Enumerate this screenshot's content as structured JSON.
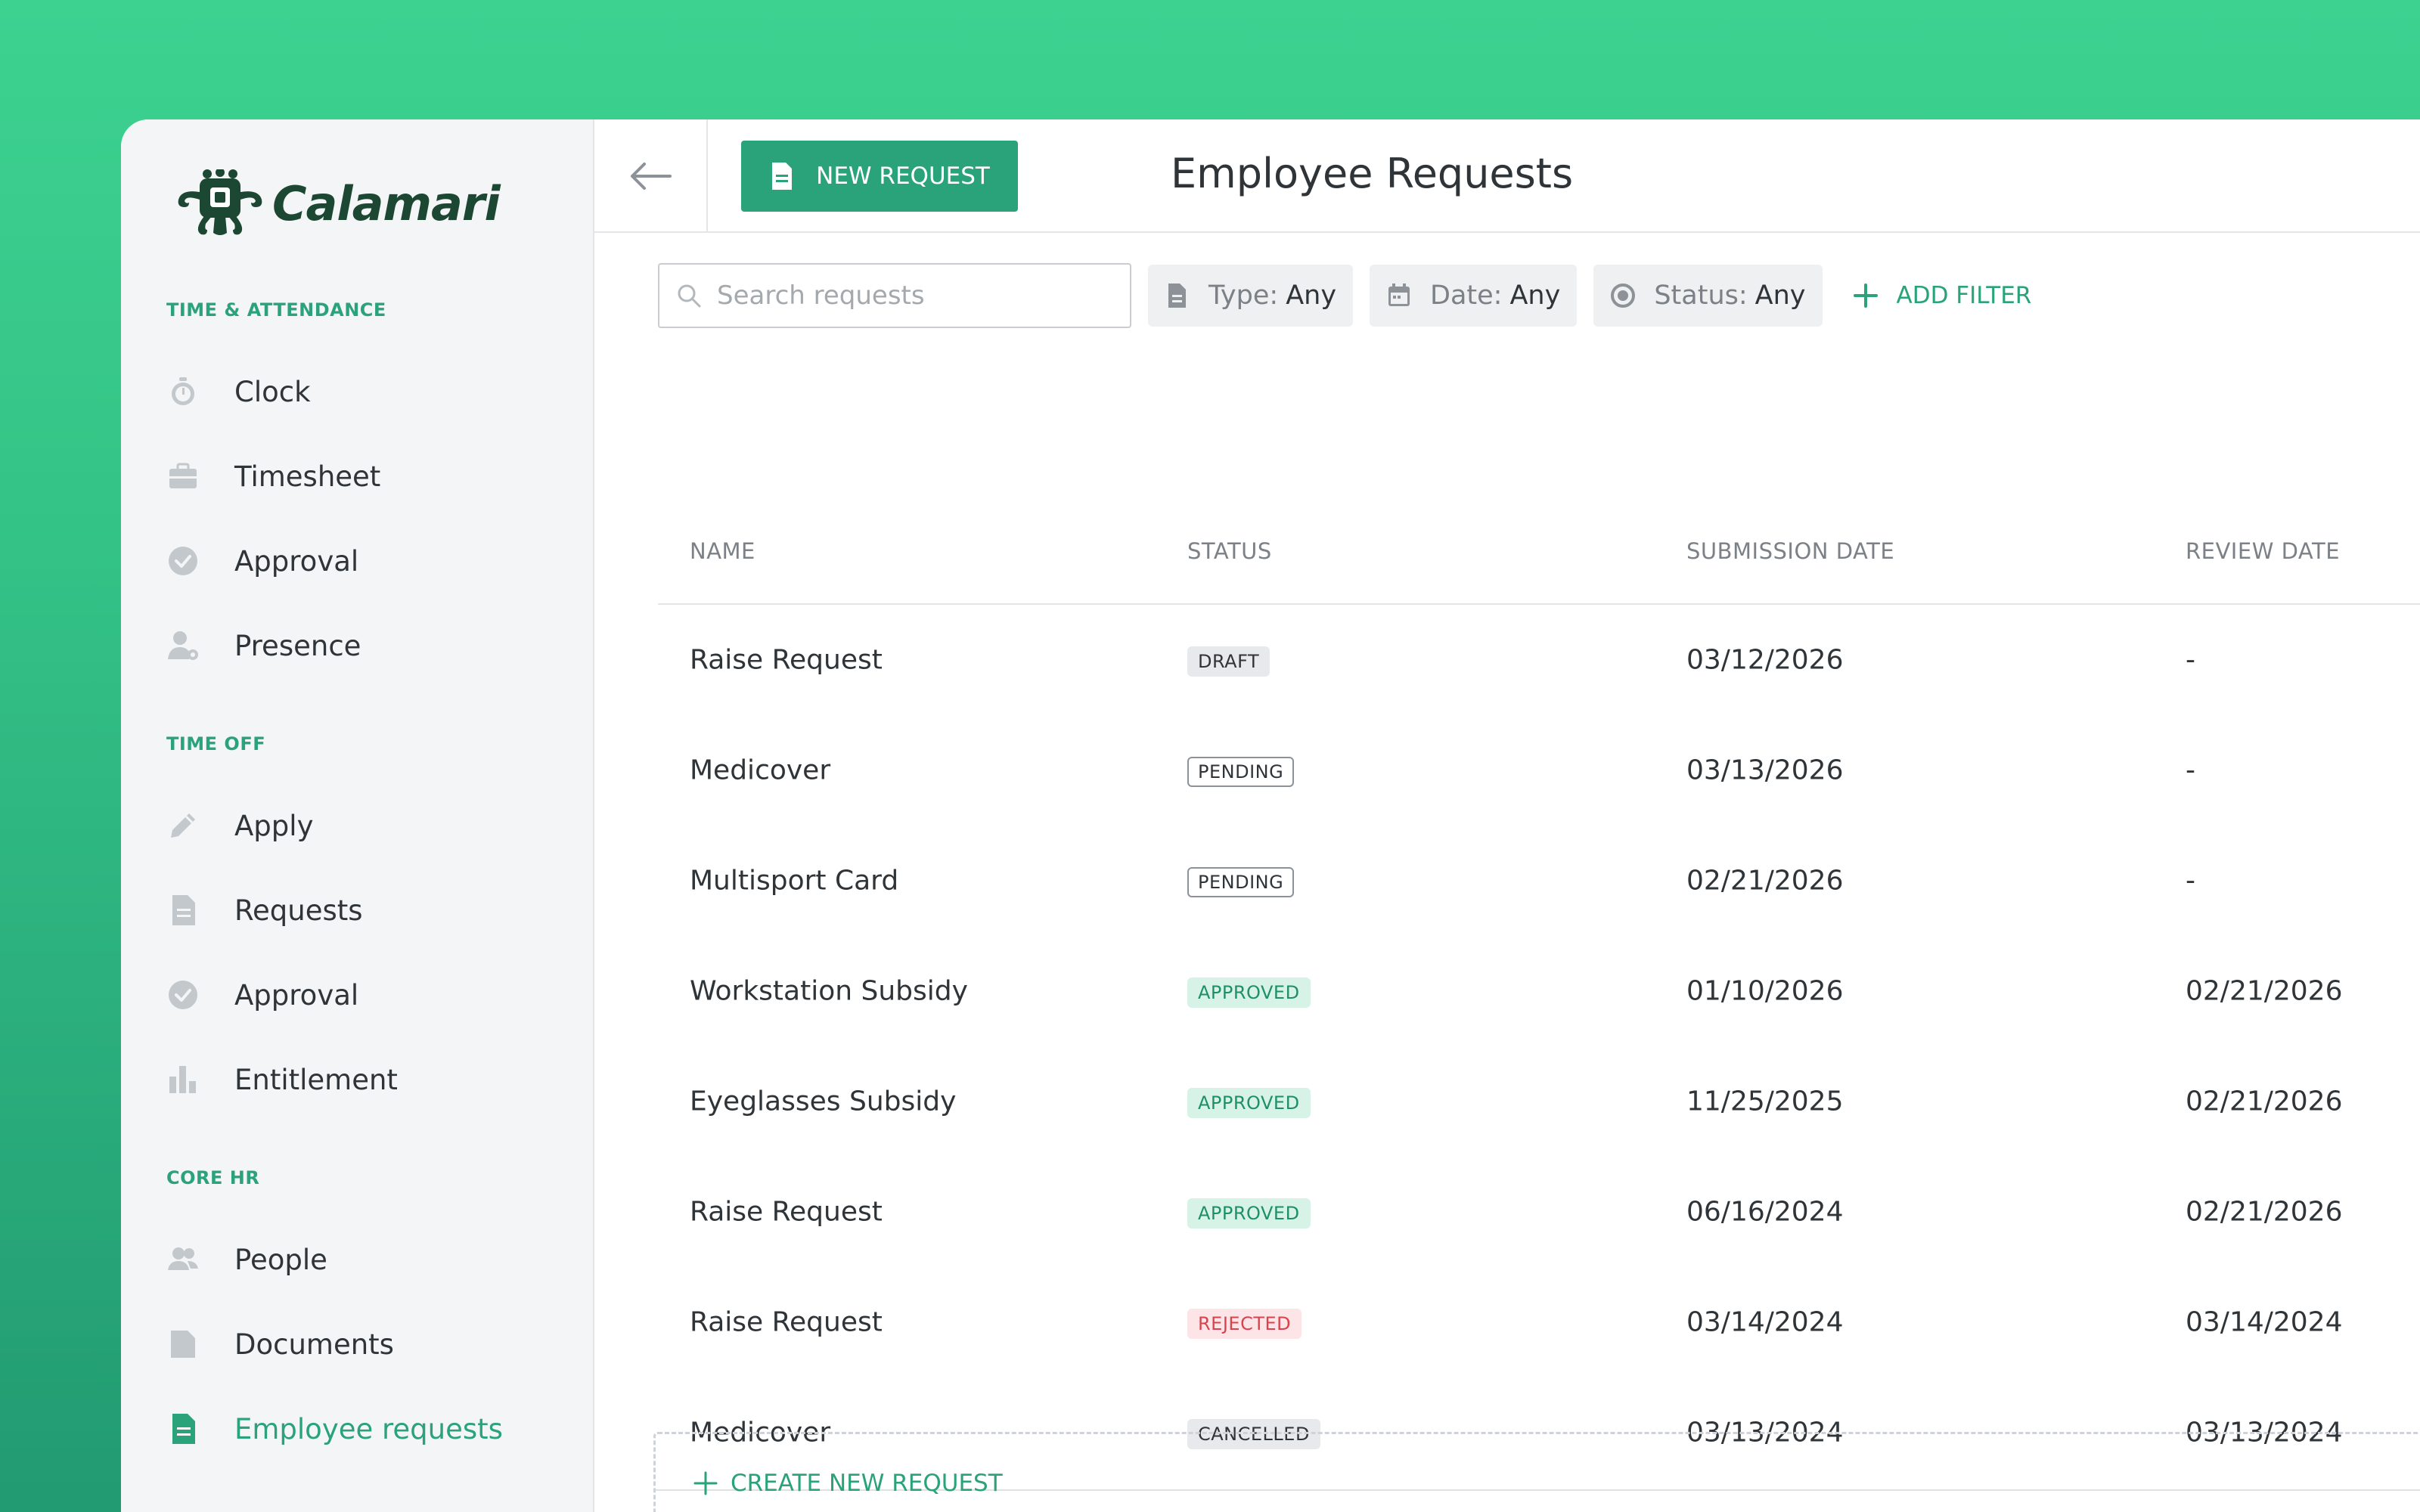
{
  "app": {
    "name": "Calamari"
  },
  "colors": {
    "accent": "#2aa37a",
    "brand_dark": "#1c4733",
    "background": "#3dd290"
  },
  "sidebar": {
    "sections": [
      {
        "title": "TIME & ATTENDANCE",
        "items": [
          {
            "label": "Clock",
            "icon": "stopwatch-icon"
          },
          {
            "label": "Timesheet",
            "icon": "briefcase-icon"
          },
          {
            "label": "Approval",
            "icon": "check-circle-icon"
          },
          {
            "label": "Presence",
            "icon": "person-pin-icon"
          }
        ]
      },
      {
        "title": "TIME OFF",
        "items": [
          {
            "label": "Apply",
            "icon": "pencil-icon"
          },
          {
            "label": "Requests",
            "icon": "document-icon"
          },
          {
            "label": "Approval",
            "icon": "check-circle-icon"
          },
          {
            "label": "Entitlement",
            "icon": "bar-chart-icon"
          }
        ]
      },
      {
        "title": "CORE HR",
        "items": [
          {
            "label": "People",
            "icon": "people-icon"
          },
          {
            "label": "Documents",
            "icon": "folder-icon"
          },
          {
            "label": "Employee requests",
            "icon": "document-icon",
            "active": true
          }
        ]
      }
    ]
  },
  "header": {
    "new_request_label": "NEW REQUEST",
    "title": "Employee Requests"
  },
  "filters": {
    "search_placeholder": "Search requests",
    "search_value": "",
    "type": {
      "key": "Type:",
      "value": "Any"
    },
    "date": {
      "key": "Date:",
      "value": "Any"
    },
    "status": {
      "key": "Status:",
      "value": "Any"
    },
    "add_filter_label": "ADD FILTER"
  },
  "table": {
    "columns": [
      "NAME",
      "STATUS",
      "SUBMISSION DATE",
      "REVIEW DATE"
    ],
    "rows": [
      {
        "name": "Raise Request",
        "status": "DRAFT",
        "status_kind": "draft",
        "submitted": "03/12/2026",
        "reviewed": "-"
      },
      {
        "name": "Medicover",
        "status": "PENDING",
        "status_kind": "pending",
        "submitted": "03/13/2026",
        "reviewed": "-"
      },
      {
        "name": "Multisport Card",
        "status": "PENDING",
        "status_kind": "pending",
        "submitted": "02/21/2026",
        "reviewed": "-"
      },
      {
        "name": "Workstation Subsidy",
        "status": "APPROVED",
        "status_kind": "approved",
        "submitted": "01/10/2026",
        "reviewed": "02/21/2026"
      },
      {
        "name": "Eyeglasses Subsidy",
        "status": "APPROVED",
        "status_kind": "approved",
        "submitted": "11/25/2025",
        "reviewed": "02/21/2026"
      },
      {
        "name": "Raise Request",
        "status": "APPROVED",
        "status_kind": "approved",
        "submitted": "06/16/2024",
        "reviewed": "02/21/2026"
      },
      {
        "name": "Raise Request",
        "status": "REJECTED",
        "status_kind": "rejected",
        "submitted": "03/14/2024",
        "reviewed": "03/14/2024"
      },
      {
        "name": "Medicover",
        "status": "CANCELLED",
        "status_kind": "cancelled",
        "submitted": "03/13/2024",
        "reviewed": "03/13/2024"
      }
    ]
  },
  "create_new_label": "CREATE NEW REQUEST"
}
